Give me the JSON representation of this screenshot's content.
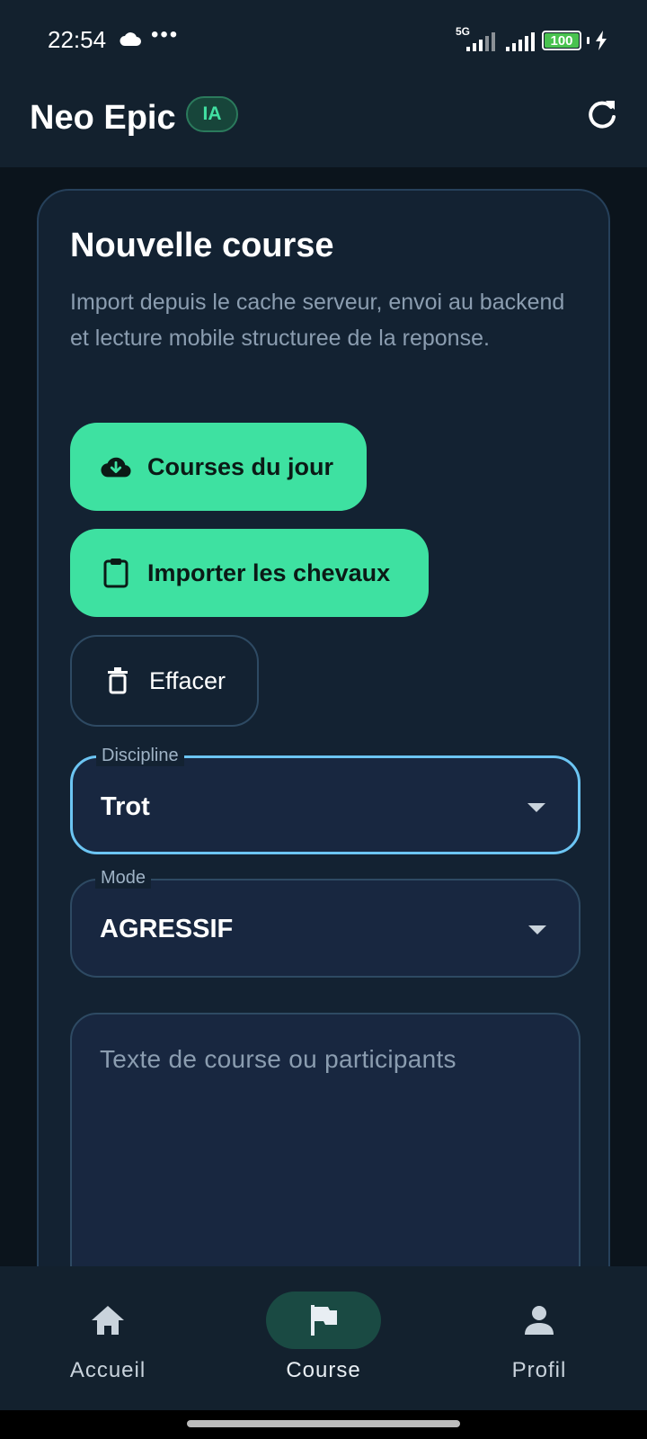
{
  "status_bar": {
    "time": "22:54",
    "network": "5G",
    "battery": "100"
  },
  "app_bar": {
    "title": "Neo Epic",
    "badge": "IA"
  },
  "card": {
    "title": "Nouvelle course",
    "description": "Import depuis le cache serveur, envoi au backend et lecture mobile structuree de la reponse.",
    "buttons": {
      "courses_du_jour": "Courses du jour",
      "importer": "Importer les chevaux",
      "effacer": "Effacer"
    },
    "discipline": {
      "label": "Discipline",
      "value": "Trot"
    },
    "mode": {
      "label": "Mode",
      "value": "AGRESSIF"
    },
    "textarea": {
      "placeholder": "Texte de course ou participants"
    }
  },
  "bottom_nav": {
    "items": [
      {
        "label": "Accueil",
        "icon": "home-icon"
      },
      {
        "label": "Course",
        "icon": "flag-icon",
        "active": true
      },
      {
        "label": "Profil",
        "icon": "person-icon"
      }
    ]
  },
  "colors": {
    "accent": "#3ee1a1",
    "focus": "#6cc5f3",
    "surface": "#132232",
    "background": "#0b141c"
  }
}
